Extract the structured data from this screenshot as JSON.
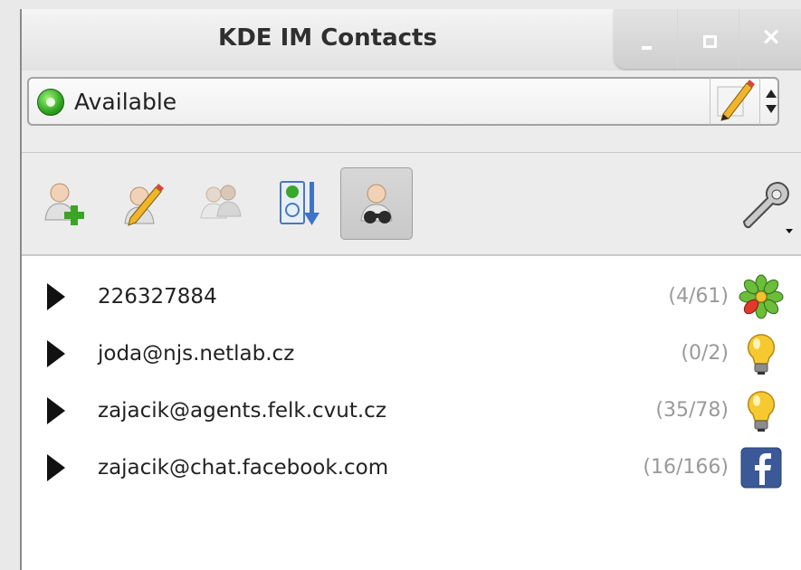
{
  "window": {
    "title": "KDE IM Contacts"
  },
  "titlebar_buttons": {
    "minimize_icon": "minimize-icon",
    "maximize_icon": "maximize-icon",
    "close_glyph": "×"
  },
  "status": {
    "label": "Available",
    "icon": "status-online-icon"
  },
  "toolbar": {
    "buttons": [
      {
        "icon": "add-contact-icon"
      },
      {
        "icon": "edit-contact-icon"
      },
      {
        "icon": "group-contacts-icon"
      },
      {
        "icon": "sort-contacts-icon"
      },
      {
        "icon": "search-contacts-icon",
        "active": true
      },
      {
        "icon": "settings-wrench-icon"
      }
    ]
  },
  "accounts": [
    {
      "name": "226327884",
      "count": "(4/61)",
      "icon": "icq-flower-icon"
    },
    {
      "name": "joda@njs.netlab.cz",
      "count": "(0/2)",
      "icon": "jabber-lightbulb-icon"
    },
    {
      "name": "zajacik@agents.felk.cvut.cz",
      "count": "(35/78)",
      "icon": "jabber-lightbulb-icon"
    },
    {
      "name": "zajacik@chat.facebook.com",
      "count": "(16/166)",
      "icon": "facebook-icon"
    }
  ],
  "colors": {
    "online_green": "#2ea620",
    "count_gray": "#9a9a9a",
    "facebook_blue": "#3b5998"
  }
}
